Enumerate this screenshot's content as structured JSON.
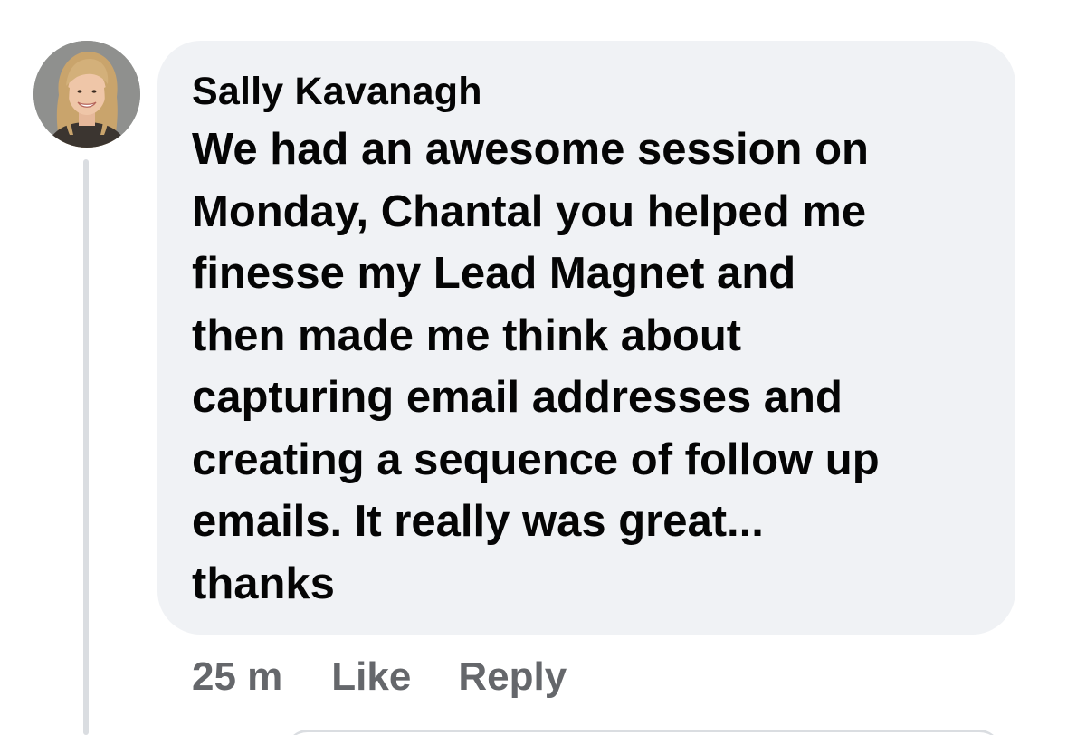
{
  "comment": {
    "author": "Sally Kavanagh",
    "text": "We had an awesome session on\nMonday, Chantal you helped me\nfinesse my Lead Magnet and\nthen made me think about\ncapturing email addresses and\ncreating a sequence of follow up\nemails. It really was great...\nthanks",
    "avatar_icon": "user-photo-avatar"
  },
  "actions": {
    "timestamp": "25 m",
    "like_label": "Like",
    "reply_label": "Reply"
  },
  "colors": {
    "bubble_bg": "#f0f2f5",
    "text": "#050505",
    "secondary_text": "#65676b",
    "thread_line": "#dadde1"
  }
}
